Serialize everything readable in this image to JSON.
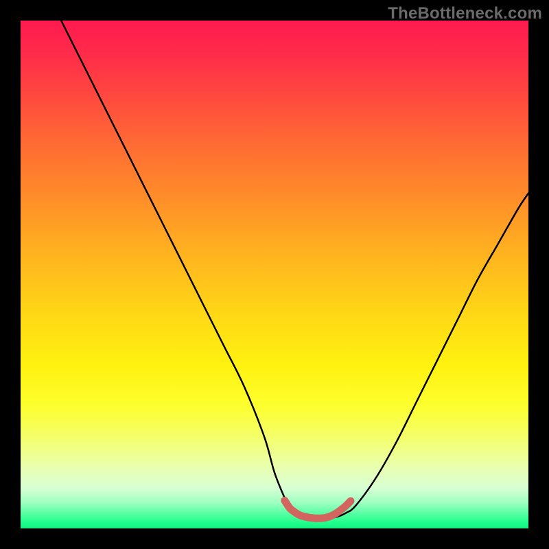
{
  "watermark": "TheBottleneck.com",
  "chart_data": {
    "type": "line",
    "title": "",
    "xlabel": "",
    "ylabel": "",
    "xlim": [
      0,
      100
    ],
    "ylim": [
      0,
      100
    ],
    "grid": false,
    "series": [
      {
        "name": "main-curve",
        "color": "#000000",
        "x": [
          8,
          12,
          16,
          20,
          24,
          28,
          32,
          36,
          40,
          44,
          48,
          50,
          52,
          53,
          54,
          56,
          58,
          60,
          62,
          64,
          66,
          70,
          74,
          78,
          82,
          86,
          90,
          94,
          98,
          100
        ],
        "y": [
          100,
          92,
          84,
          76,
          68,
          60,
          52,
          44,
          36,
          28,
          18,
          11,
          6,
          4,
          3,
          2.2,
          2,
          2,
          2.2,
          3,
          4.5,
          10,
          17,
          25,
          33,
          41,
          49,
          56,
          63,
          66
        ]
      },
      {
        "name": "bottom-highlight",
        "color": "#d2655f",
        "x": [
          52,
          53,
          54,
          55,
          56,
          57,
          58,
          59,
          60,
          61,
          62,
          63,
          64,
          65
        ],
        "y": [
          5.5,
          4,
          3.2,
          2.6,
          2.3,
          2.1,
          2,
          2,
          2.1,
          2.4,
          2.9,
          3.6,
          4.4,
          5.4
        ]
      }
    ],
    "background_gradient": {
      "direction": "vertical",
      "stops": [
        {
          "pos": 0.0,
          "color": "#ff1a4f"
        },
        {
          "pos": 0.24,
          "color": "#ff6a34"
        },
        {
          "pos": 0.58,
          "color": "#ffd816"
        },
        {
          "pos": 0.82,
          "color": "#f4ff6a"
        },
        {
          "pos": 0.95,
          "color": "#9cffc0"
        },
        {
          "pos": 1.0,
          "color": "#15ef82"
        }
      ]
    }
  }
}
